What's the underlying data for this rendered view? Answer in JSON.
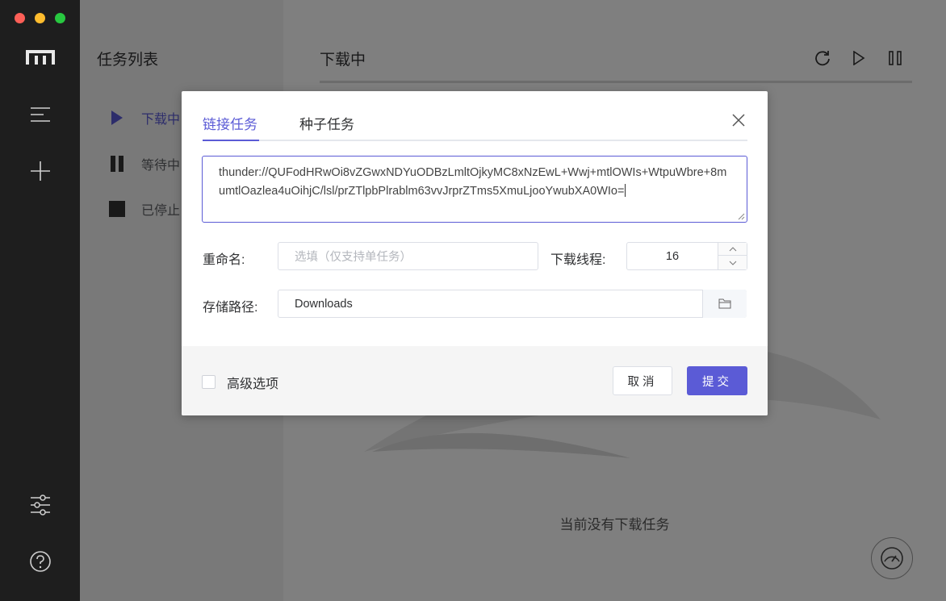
{
  "sidebar": {
    "logo_icon": "m-logo-icon",
    "items": [
      {
        "name": "list-icon"
      },
      {
        "name": "plus-icon"
      },
      {
        "name": "sliders-icon"
      },
      {
        "name": "help-icon"
      }
    ]
  },
  "task_list": {
    "title": "任务列表",
    "items": [
      {
        "label": "下载中",
        "icon": "play-icon"
      },
      {
        "label": "等待中",
        "icon": "pause-icon"
      },
      {
        "label": "已停止",
        "icon": "stop-icon"
      }
    ]
  },
  "main": {
    "title": "下载中",
    "empty_text": "当前没有下载任务",
    "toolbar": [
      "refresh-icon",
      "resume-icon",
      "pause-all-icon"
    ]
  },
  "dialog": {
    "tabs": [
      {
        "label": "链接任务",
        "active": true
      },
      {
        "label": "种子任务",
        "active": false
      }
    ],
    "uri": "thunder://QUFodHRwOi8vZGwxNDYuODBzLmltOjkyMC8xNzEwL+Wwj+mtlOWIs+WtpuWbre+8mumtlOazlea4uOihjC/lsl/prZTlpbPlrablm63vvJrprZTms5XmuLjooYwubXA0WIo=",
    "rename_label": "重命名:",
    "rename_placeholder": "选填（仅支持单任务）",
    "threads_label": "下载线程:",
    "threads_value": "16",
    "path_label": "存储路径:",
    "path_value": "Downloads",
    "advanced_label": "高级选项",
    "cancel_label": "取消",
    "submit_label": "提交"
  },
  "colors": {
    "accent": "#5b5bd6",
    "sidebar_bg": "#1e1e1e"
  }
}
